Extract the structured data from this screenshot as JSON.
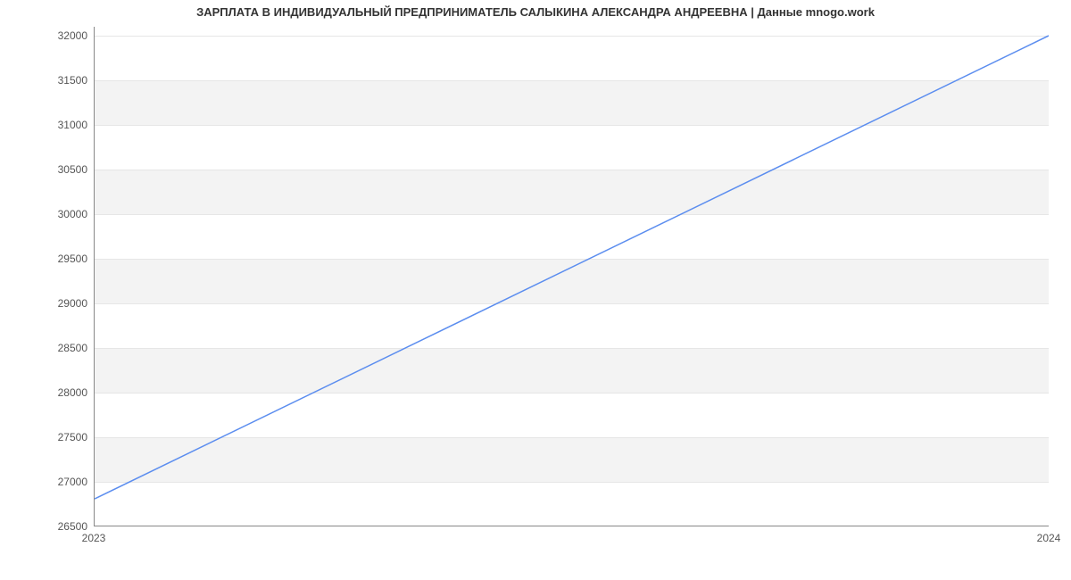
{
  "chart_data": {
    "type": "line",
    "title": "ЗАРПЛАТА В ИНДИВИДУАЛЬНЫЙ ПРЕДПРИНИМАТЕЛЬ САЛЫКИНА АЛЕКСАНДРА АНДРЕЕВНА | Данные mnogo.work",
    "xlabel": "",
    "ylabel": "",
    "x_categories": [
      "2023",
      "2024"
    ],
    "x": [
      0,
      1
    ],
    "values": [
      26800,
      32000
    ],
    "ylim": [
      26500,
      32100
    ],
    "yticks": [
      26500,
      27000,
      27500,
      28000,
      28500,
      29000,
      29500,
      30000,
      30500,
      31000,
      31500,
      32000
    ],
    "grid": true,
    "legend": false,
    "line_color": "#5b8def"
  }
}
